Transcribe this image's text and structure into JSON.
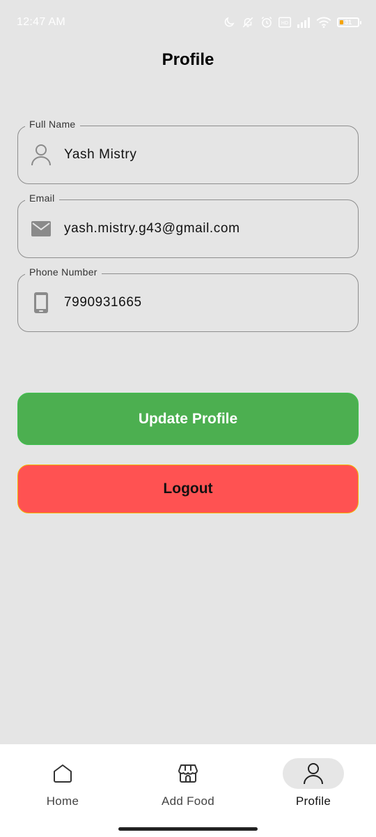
{
  "status_bar": {
    "time": "12:47 AM",
    "battery_level": "31",
    "icons": [
      "moon-icon",
      "bell-off-icon",
      "alarm-icon",
      "volte-icon",
      "signal-icon",
      "wifi-icon",
      "battery-icon"
    ]
  },
  "header": {
    "title": "Profile"
  },
  "form": {
    "full_name": {
      "label": "Full Name",
      "value": "Yash Mistry",
      "icon": "person-icon"
    },
    "email": {
      "label": "Email",
      "value": "yash.mistry.g43@gmail.com",
      "icon": "mail-icon"
    },
    "phone": {
      "label": "Phone Number",
      "value": "7990931665",
      "icon": "phone-icon"
    }
  },
  "buttons": {
    "update": "Update Profile",
    "logout": "Logout"
  },
  "bottom_nav": {
    "items": [
      {
        "label": "Home",
        "icon": "home-icon",
        "active": false
      },
      {
        "label": "Add Food",
        "icon": "store-icon",
        "active": false
      },
      {
        "label": "Profile",
        "icon": "person-icon",
        "active": true
      }
    ]
  },
  "colors": {
    "background": "#e5e5e5",
    "update_button": "#4caf50",
    "logout_button": "#ff5252",
    "logout_border": "#f5b400"
  }
}
